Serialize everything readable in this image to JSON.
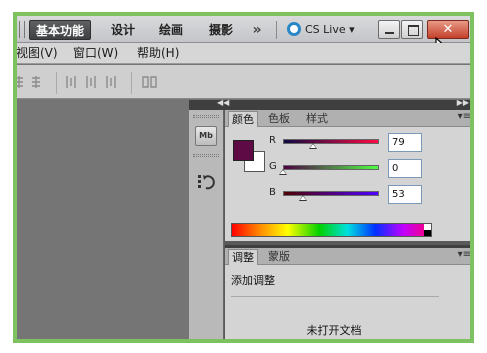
{
  "titlebar": {
    "workspace_active": "基本功能",
    "workspace_design": "设计",
    "workspace_paint": "绘画",
    "workspace_photo": "摄影",
    "more_glyph": "»",
    "cs_live": "CS Live ▾",
    "close_glyph": "✕"
  },
  "menubar": {
    "view": "视图(V)",
    "window": "窗口(W)",
    "help": "帮助(H)"
  },
  "color_panel": {
    "tabs": [
      "颜色",
      "色板",
      "样式"
    ],
    "foreground_color": "#5e0a44",
    "sliders": [
      {
        "label": "R",
        "value": "79",
        "fraction": 0.31,
        "track": "linear-gradient(to right,#0e0a44,#ff0a44)"
      },
      {
        "label": "G",
        "value": "0",
        "fraction": 0.0,
        "track": "linear-gradient(to right,#4f0044,#4fff44)"
      },
      {
        "label": "B",
        "value": "53",
        "fraction": 0.21,
        "track": "linear-gradient(to right,#4f0000,#4f00ff)"
      }
    ]
  },
  "adjust_panel": {
    "tabs": [
      "调整",
      "蒙版"
    ],
    "title": "添加调整",
    "empty_message": "未打开文档"
  },
  "dock": {
    "strip_button": "Mb"
  },
  "colors": {
    "frame": "#7dc160",
    "canvas": "#757575"
  }
}
